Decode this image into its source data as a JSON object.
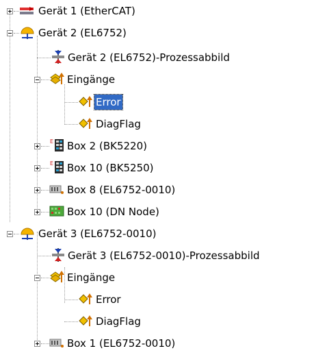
{
  "tree": {
    "items": [
      {
        "label": "Gerät 1 (EtherCAT)",
        "icon": "ethercat-device-icon",
        "expander": "plus"
      },
      {
        "label": "Gerät 2 (EL6752)",
        "icon": "fieldbus-device-icon",
        "expander": "minus"
      },
      {
        "label": "Gerät 2 (EL6752)-Prozessabbild",
        "icon": "process-image-icon",
        "expander": "none"
      },
      {
        "label": "Eingänge",
        "icon": "inputs-folder-icon",
        "expander": "minus"
      },
      {
        "label": "Error",
        "icon": "input-variable-icon",
        "expander": "none",
        "selected": true
      },
      {
        "label": "DiagFlag",
        "icon": "input-variable-icon",
        "expander": "none"
      },
      {
        "label": "Box 2  (BK5220)",
        "icon": "bus-coupler-icon",
        "expander": "plus"
      },
      {
        "label": "Box 10  (BK5250)",
        "icon": "bus-coupler-icon",
        "expander": "plus"
      },
      {
        "label": "Box 8 (EL6752-0010)",
        "icon": "terminal-box-icon",
        "expander": "plus"
      },
      {
        "label": "Box 10 (DN Node)",
        "icon": "dn-node-icon",
        "expander": "plus"
      },
      {
        "label": "Gerät 3 (EL6752-0010)",
        "icon": "fieldbus-device-icon",
        "expander": "minus"
      },
      {
        "label": "Gerät 3 (EL6752-0010)-Prozessabbild",
        "icon": "process-image-icon",
        "expander": "none"
      },
      {
        "label": "Eingänge",
        "icon": "inputs-folder-icon",
        "expander": "minus"
      },
      {
        "label": "Error",
        "icon": "input-variable-icon",
        "expander": "none"
      },
      {
        "label": "DiagFlag",
        "icon": "input-variable-icon",
        "expander": "none"
      },
      {
        "label": "Box 1 (EL6752-0010)",
        "icon": "terminal-box-icon",
        "expander": "plus"
      }
    ],
    "colors": {
      "selection": "#316ac5",
      "connector": "#9a9a9a"
    }
  }
}
